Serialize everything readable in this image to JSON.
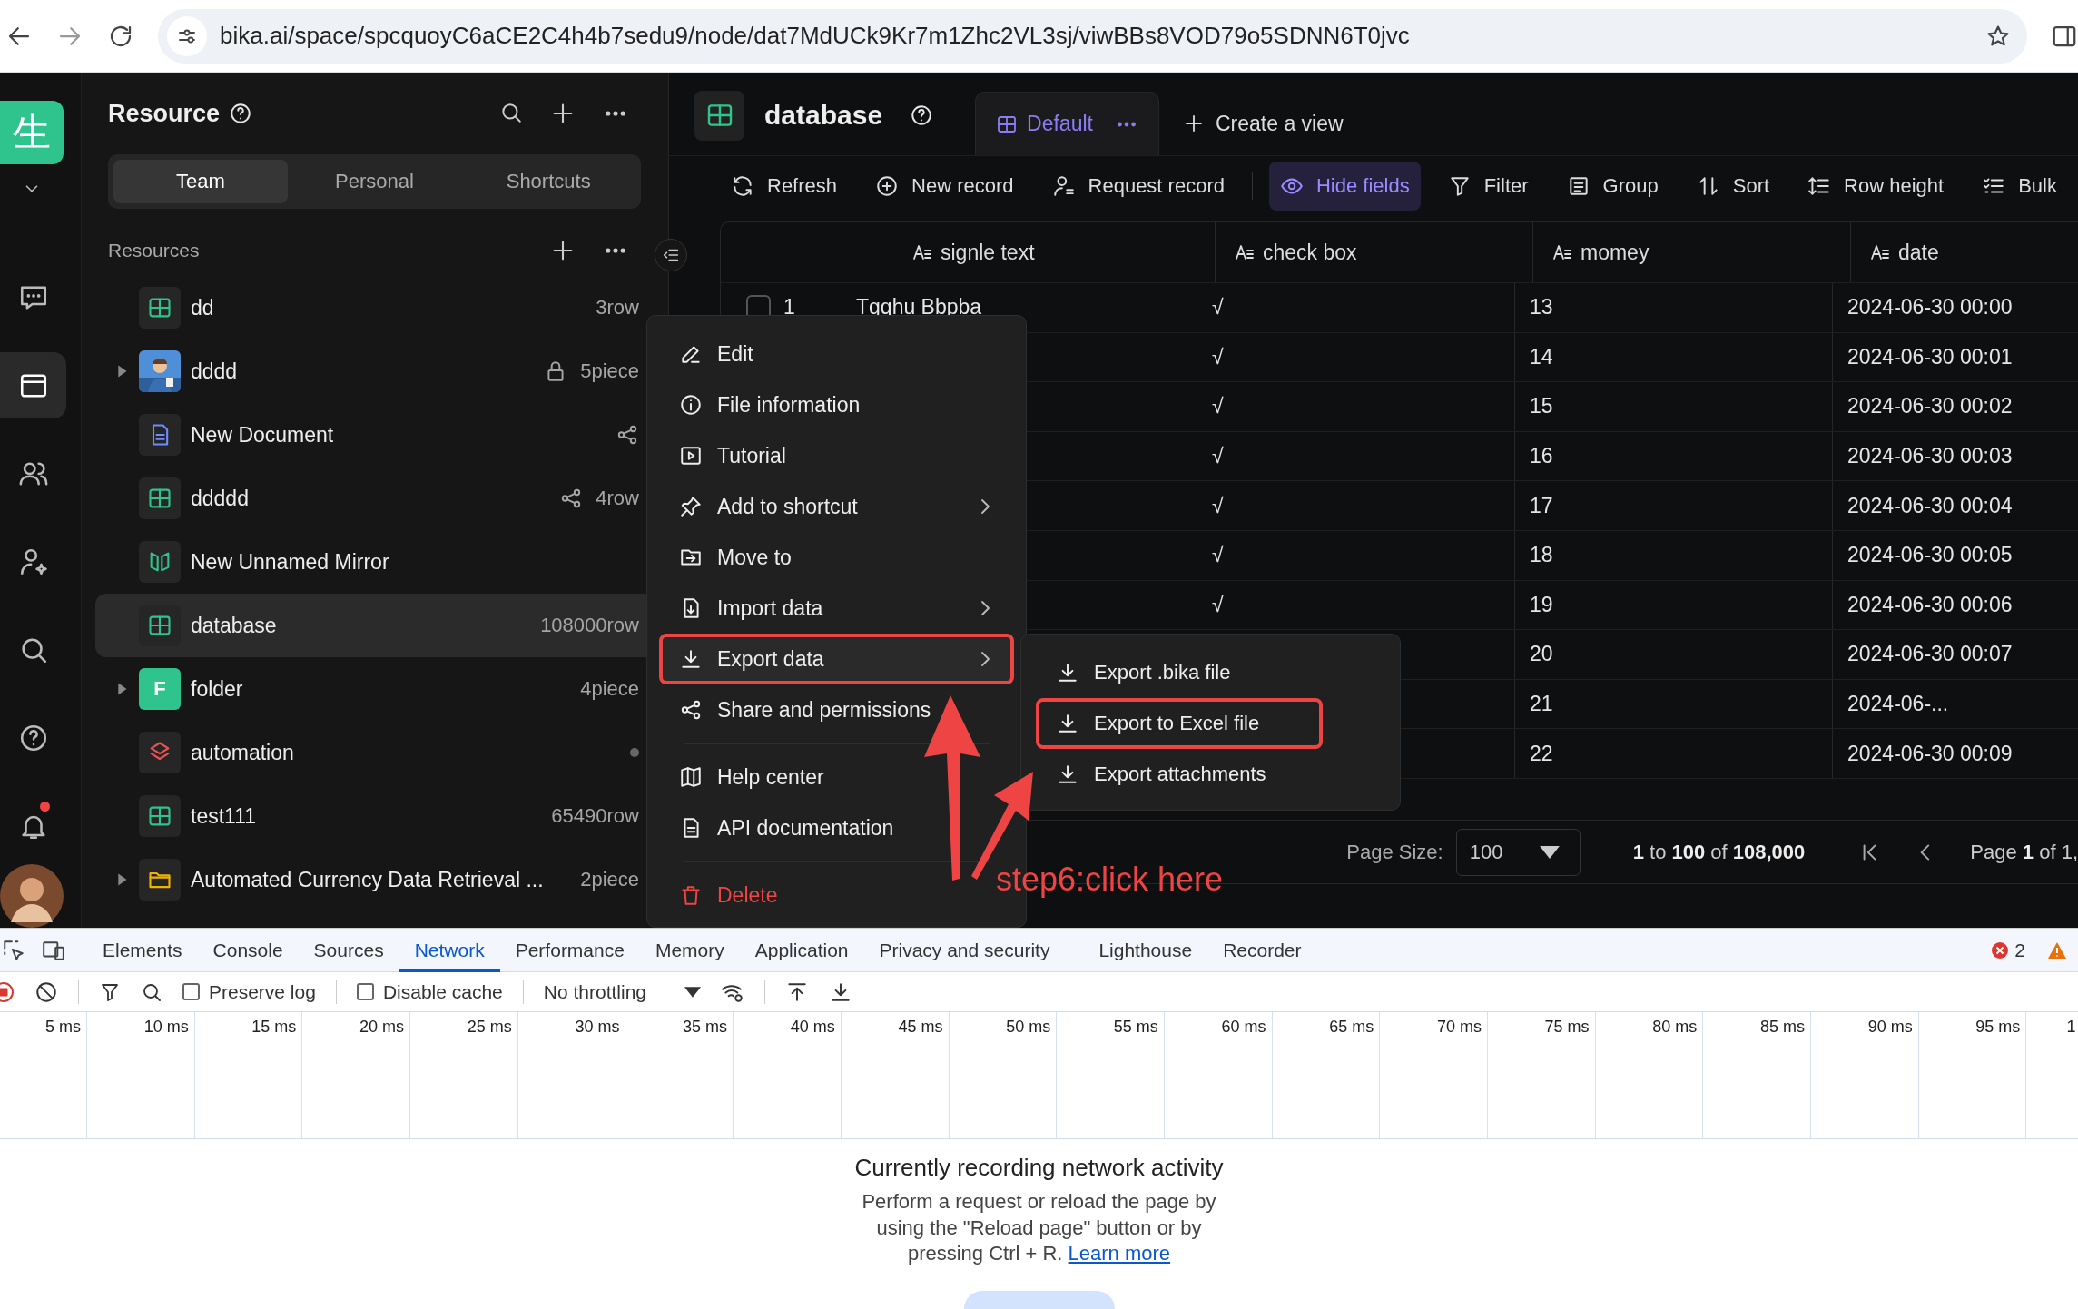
{
  "browser": {
    "url": "bika.ai/space/spcquoyC6aCE2C4h4b7sedu9/node/dat7MdUCk9Kr7m1Zhc2VL3sj/viwBBs8VOD79o5SDNN6T0jvc"
  },
  "rail": {
    "logo": "生",
    "items": [
      {
        "selected": false,
        "unread": false
      },
      {
        "selected": true,
        "unread": false
      },
      {
        "selected": false,
        "unread": false
      },
      {
        "selected": false,
        "unread": false
      },
      {
        "selected": false,
        "unread": false
      },
      {
        "selected": false,
        "unread": false
      },
      {
        "selected": false,
        "unread": true
      }
    ]
  },
  "resource_panel": {
    "title": "Resource",
    "tabs": [
      {
        "label": "Team",
        "selected": true
      },
      {
        "label": "Personal",
        "selected": false
      },
      {
        "label": "Shortcuts",
        "selected": false
      }
    ],
    "section": "Resources",
    "items": [
      {
        "name": "dd",
        "kind": "table",
        "meta": "3row",
        "expandable": false,
        "selected": false,
        "locked": false,
        "shared": false,
        "dot": false
      },
      {
        "name": "dddd",
        "kind": "picture",
        "meta": "5piece",
        "expandable": true,
        "selected": false,
        "locked": true,
        "shared": false,
        "dot": false
      },
      {
        "name": "New Document",
        "kind": "document",
        "expandable": false,
        "selected": false,
        "locked": false,
        "shared": true,
        "dot": false
      },
      {
        "name": "ddddd",
        "kind": "table",
        "meta": "4row",
        "expandable": false,
        "selected": false,
        "locked": false,
        "shared": true,
        "dot": false
      },
      {
        "name": "New Unnamed Mirror",
        "kind": "mirror",
        "expandable": false,
        "selected": false,
        "locked": false,
        "shared": false,
        "dot": false
      },
      {
        "name": "database",
        "kind": "table",
        "meta": "108000row",
        "expandable": false,
        "selected": true,
        "locked": false,
        "shared": false,
        "dot": false
      },
      {
        "name": "folder",
        "kind": "letter",
        "letter": "F",
        "meta": "4piece",
        "expandable": true,
        "selected": false,
        "locked": false,
        "shared": false,
        "dot": false
      },
      {
        "name": "automation",
        "kind": "automation",
        "expandable": false,
        "selected": false,
        "locked": false,
        "shared": false,
        "dot": true
      },
      {
        "name": "test111",
        "kind": "table",
        "meta": "65490row",
        "expandable": false,
        "selected": false,
        "locked": false,
        "shared": false,
        "dot": false
      },
      {
        "name": "Automated Currency Data Retrieval ...",
        "kind": "folder",
        "meta": "2piece",
        "expandable": true,
        "selected": false,
        "locked": false,
        "shared": false,
        "dot": false
      }
    ]
  },
  "main": {
    "title": "database",
    "views": [
      {
        "label": "Default",
        "selected": true
      }
    ],
    "create_view": "Create a view",
    "toolbar": [
      {
        "label": "Refresh",
        "selected": false
      },
      {
        "label": "New record",
        "selected": false
      },
      {
        "label": "Request record",
        "selected": false
      },
      {
        "label": "Hide fields",
        "selected": true
      },
      {
        "label": "Filter",
        "selected": false
      },
      {
        "label": "Group",
        "selected": false
      },
      {
        "label": "Sort",
        "selected": false
      },
      {
        "label": "Row height",
        "selected": false
      },
      {
        "label": "Bulk",
        "selected": false
      }
    ],
    "table": {
      "columns": [
        "signle text",
        "check box",
        "momey",
        "date"
      ],
      "rows": [
        {
          "number": "1",
          "checked": false,
          "text": "Tgqhu Bbpba",
          "check": "√",
          "money": "13",
          "date": "2024-06-30 00:00"
        },
        {
          "check": "√",
          "money": "14",
          "date": "2024-06-30 00:01"
        },
        {
          "check": "√",
          "money": "15",
          "date": "2024-06-30 00:02"
        },
        {
          "check": "√",
          "money": "16",
          "date": "2024-06-30 00:03"
        },
        {
          "check": "√",
          "money": "17",
          "date": "2024-06-30 00:04"
        },
        {
          "check": "√",
          "money": "18",
          "date": "2024-06-30 00:05"
        },
        {
          "check": "√",
          "money": "19",
          "date": "2024-06-30 00:06"
        },
        {
          "money": "20",
          "date": "2024-06-30 00:07"
        },
        {
          "money": "21",
          "date": "2024-06-..."
        },
        {
          "money": "22",
          "date": "2024-06-30 00:09"
        }
      ]
    },
    "footer": {
      "page_size_label": "Page Size:",
      "page_size": "100",
      "range": "**1** to **100** of **108,000**",
      "page": "Page **1** of 1,"
    }
  },
  "context_menu": {
    "items": [
      {
        "kind": "item",
        "label": "Edit",
        "submenu": false,
        "highlighted": false
      },
      {
        "kind": "item",
        "label": "File information",
        "submenu": false,
        "highlighted": false
      },
      {
        "kind": "item",
        "label": "Tutorial",
        "submenu": false,
        "highlighted": false
      },
      {
        "kind": "item",
        "label": "Add to shortcut",
        "submenu": true,
        "highlighted": false
      },
      {
        "kind": "item",
        "label": "Move to",
        "submenu": false,
        "highlighted": false
      },
      {
        "kind": "item",
        "label": "Import data",
        "submenu": true,
        "highlighted": false
      },
      {
        "kind": "item",
        "label": "Export data",
        "submenu": true,
        "highlighted": true
      },
      {
        "kind": "item",
        "label": "Share and permissions",
        "submenu": false,
        "highlighted": false
      },
      {
        "kind": "divider"
      },
      {
        "kind": "item",
        "label": "Help center",
        "submenu": false,
        "highlighted": false
      },
      {
        "kind": "item",
        "label": "API documentation",
        "submenu": false,
        "highlighted": false
      },
      {
        "kind": "divider"
      },
      {
        "kind": "danger",
        "label": "Delete",
        "submenu": false,
        "highlighted": false
      }
    ],
    "submenu": [
      {
        "label": "Export .bika file",
        "highlighted": false
      },
      {
        "label": "Export to Excel file",
        "highlighted": true
      },
      {
        "label": "Export attachments",
        "highlighted": false
      }
    ]
  },
  "annotation": {
    "label": "step6:click here"
  },
  "devtools": {
    "tabs": [
      {
        "label": "Elements",
        "selected": false
      },
      {
        "label": "Console",
        "selected": false
      },
      {
        "label": "Sources",
        "selected": false
      },
      {
        "label": "Network",
        "selected": true
      },
      {
        "label": "Performance",
        "selected": false
      },
      {
        "label": "Memory",
        "selected": false
      },
      {
        "label": "Application",
        "selected": false
      },
      {
        "label": "Privacy and security",
        "selected": false
      },
      {
        "label": "Lighthouse",
        "selected": false
      },
      {
        "label": "Recorder",
        "selected": false
      }
    ],
    "error_count": "2",
    "options": [
      {
        "label": "Preserve log",
        "checked": false
      },
      {
        "label": "Disable cache",
        "checked": false
      }
    ],
    "throttling": "No throttling",
    "ticks": [
      "5 ms",
      "10 ms",
      "15 ms",
      "20 ms",
      "25 ms",
      "30 ms",
      "35 ms",
      "40 ms",
      "45 ms",
      "50 ms",
      "55 ms",
      "60 ms",
      "65 ms",
      "70 ms",
      "75 ms",
      "80 ms",
      "85 ms",
      "90 ms",
      "95 ms",
      "1"
    ],
    "empty_title": "Currently recording network activity",
    "empty_text": "Perform a request or reload the page by using the \"Reload page\" button or by pressing Ctrl + R.",
    "learn_more": "Learn more"
  }
}
